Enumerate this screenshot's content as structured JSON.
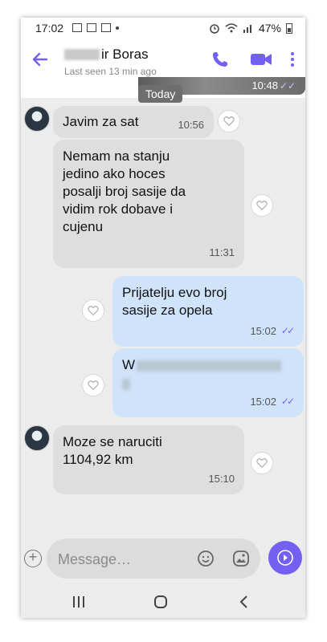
{
  "status_bar": {
    "time": "17:02",
    "battery": "47%"
  },
  "header": {
    "contact_name": "ir Boras",
    "last_seen": "Last seen 13 min ago",
    "icons": [
      "back-arrow-icon",
      "phone-icon",
      "video-call-icon",
      "more-menu-icon"
    ]
  },
  "previous_message": {
    "time": "10:48"
  },
  "date_separator": "Today",
  "messages": [
    {
      "direction": "incoming",
      "text": "Javim za sat",
      "time": "10:56"
    },
    {
      "direction": "incoming",
      "text": "Nemam na stanju\njedino ako hoces\nposalji broj sasije da\nvidim rok dobave i\ncujenu",
      "time": "11:31"
    },
    {
      "direction": "outgoing",
      "text": "Prijatelju evo broj\nsasije za opela",
      "time": "15:02"
    },
    {
      "direction": "outgoing",
      "text": "W",
      "time": "15:02"
    },
    {
      "direction": "incoming",
      "text": "Moze se naruciti\n1104,92 km",
      "time": "15:10"
    }
  ],
  "composer": {
    "placeholder": "Message…"
  },
  "colors": {
    "accent": "#7360f2",
    "incoming_bubble": "#dedede",
    "outgoing_bubble": "#cfe4fb"
  }
}
